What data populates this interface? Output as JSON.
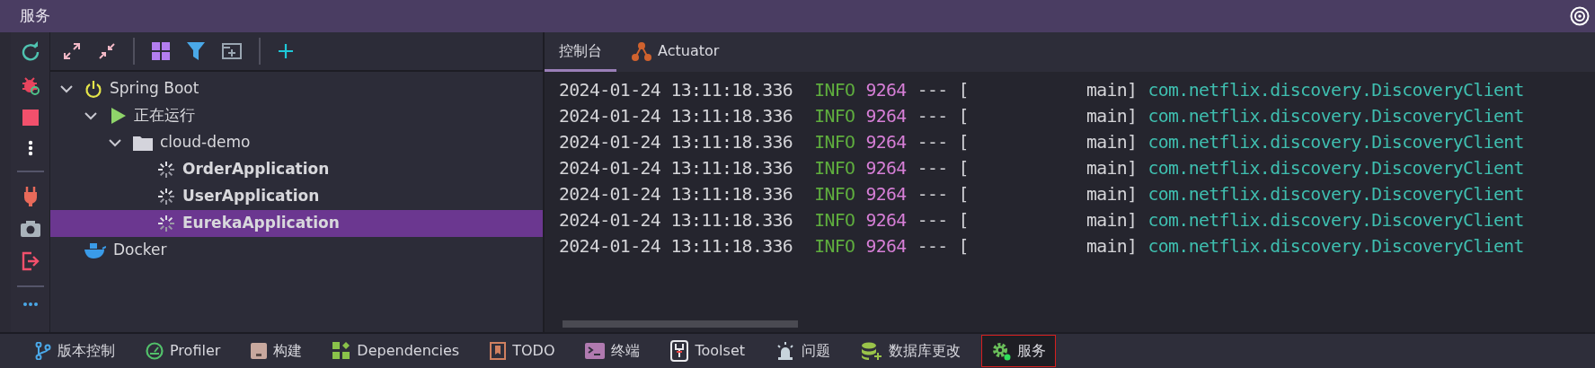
{
  "window": {
    "title": "服务"
  },
  "tree": [
    {
      "label": "Spring Boot",
      "kind": "spring",
      "expanded": true,
      "selected": false,
      "children": [
        {
          "label": "正在运行",
          "kind": "run",
          "expanded": true,
          "selected": false,
          "children": [
            {
              "label": "cloud-demo",
              "kind": "folder",
              "expanded": true,
              "selected": false,
              "children": [
                {
                  "label": "OrderApplication",
                  "kind": "app",
                  "selected": false
                },
                {
                  "label": "UserApplication",
                  "kind": "app",
                  "selected": false
                },
                {
                  "label": "EurekaApplication",
                  "kind": "app",
                  "selected": true
                }
              ]
            }
          ]
        }
      ]
    },
    {
      "label": "Docker",
      "kind": "docker",
      "selected": false
    }
  ],
  "tabs": [
    {
      "label": "控制台",
      "kind": "console",
      "selected": true
    },
    {
      "label": "Actuator",
      "kind": "actuator",
      "selected": false
    }
  ],
  "log": [
    {
      "timestamp": "2024-01-24 13:11:18.336",
      "level": "INFO",
      "pid": "9264",
      "separator": "---",
      "bracket": "[",
      "thread": "main]",
      "logger": "com.netflix.discovery.DiscoveryClient"
    },
    {
      "timestamp": "2024-01-24 13:11:18.336",
      "level": "INFO",
      "pid": "9264",
      "separator": "---",
      "bracket": "[",
      "thread": "main]",
      "logger": "com.netflix.discovery.DiscoveryClient"
    },
    {
      "timestamp": "2024-01-24 13:11:18.336",
      "level": "INFO",
      "pid": "9264",
      "separator": "---",
      "bracket": "[",
      "thread": "main]",
      "logger": "com.netflix.discovery.DiscoveryClient"
    },
    {
      "timestamp": "2024-01-24 13:11:18.336",
      "level": "INFO",
      "pid": "9264",
      "separator": "---",
      "bracket": "[",
      "thread": "main]",
      "logger": "com.netflix.discovery.DiscoveryClient"
    },
    {
      "timestamp": "2024-01-24 13:11:18.336",
      "level": "INFO",
      "pid": "9264",
      "separator": "---",
      "bracket": "[",
      "thread": "main]",
      "logger": "com.netflix.discovery.DiscoveryClient"
    },
    {
      "timestamp": "2024-01-24 13:11:18.336",
      "level": "INFO",
      "pid": "9264",
      "separator": "---",
      "bracket": "[",
      "thread": "main]",
      "logger": "com.netflix.discovery.DiscoveryClient"
    },
    {
      "timestamp": "2024-01-24 13:11:18.336",
      "level": "INFO",
      "pid": "9264",
      "separator": "---",
      "bracket": "[",
      "thread": "main]",
      "logger": "com.netflix.discovery.DiscoveryClient"
    }
  ],
  "tool_windows": [
    {
      "label": "版本控制",
      "kind": "vcs",
      "selected": false
    },
    {
      "label": "Profiler",
      "kind": "profiler",
      "selected": false
    },
    {
      "label": "构建",
      "kind": "build",
      "selected": false
    },
    {
      "label": "Dependencies",
      "kind": "dependencies",
      "selected": false
    },
    {
      "label": "TODO",
      "kind": "todo",
      "selected": false
    },
    {
      "label": "终端",
      "kind": "terminal",
      "selected": false
    },
    {
      "label": "Toolset",
      "kind": "toolset",
      "selected": false
    },
    {
      "label": "问题",
      "kind": "problems",
      "selected": false
    },
    {
      "label": "数据库更改",
      "kind": "database",
      "selected": false
    },
    {
      "label": "服务",
      "kind": "services",
      "selected": true
    }
  ]
}
